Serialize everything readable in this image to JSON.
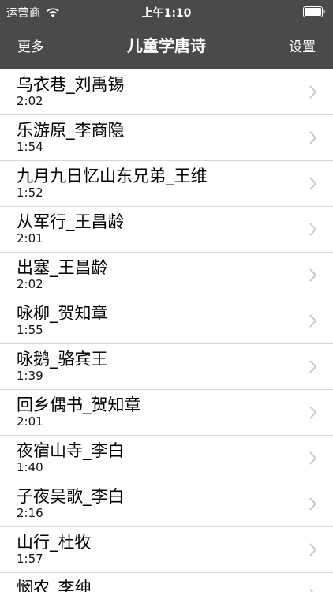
{
  "status_bar": {
    "carrier": "运营商",
    "time": "上午1:10"
  },
  "nav": {
    "left_label": "更多",
    "title": "儿童学唐诗",
    "right_label": "设置"
  },
  "list": {
    "items": [
      {
        "title": "乌衣巷_刘禹锡",
        "duration": "2:02"
      },
      {
        "title": "乐游原_李商隐",
        "duration": "1:54"
      },
      {
        "title": "九月九日忆山东兄弟_王维",
        "duration": "1:52"
      },
      {
        "title": "从军行_王昌龄",
        "duration": "2:01"
      },
      {
        "title": "出塞_王昌龄",
        "duration": "2:02"
      },
      {
        "title": "咏柳_贺知章",
        "duration": "1:55"
      },
      {
        "title": "咏鹅_骆宾王",
        "duration": "1:39"
      },
      {
        "title": "回乡偶书_贺知章",
        "duration": "2:01"
      },
      {
        "title": "夜宿山寺_李白",
        "duration": "1:40"
      },
      {
        "title": "子夜吴歌_李白",
        "duration": "2:16"
      },
      {
        "title": "山行_杜牧",
        "duration": "1:57"
      },
      {
        "title": "悯农_李绅",
        "duration": ""
      }
    ]
  },
  "icons": {
    "wifi": "wifi-icon",
    "battery": "battery-icon",
    "chevron": "chevron-right-icon"
  }
}
